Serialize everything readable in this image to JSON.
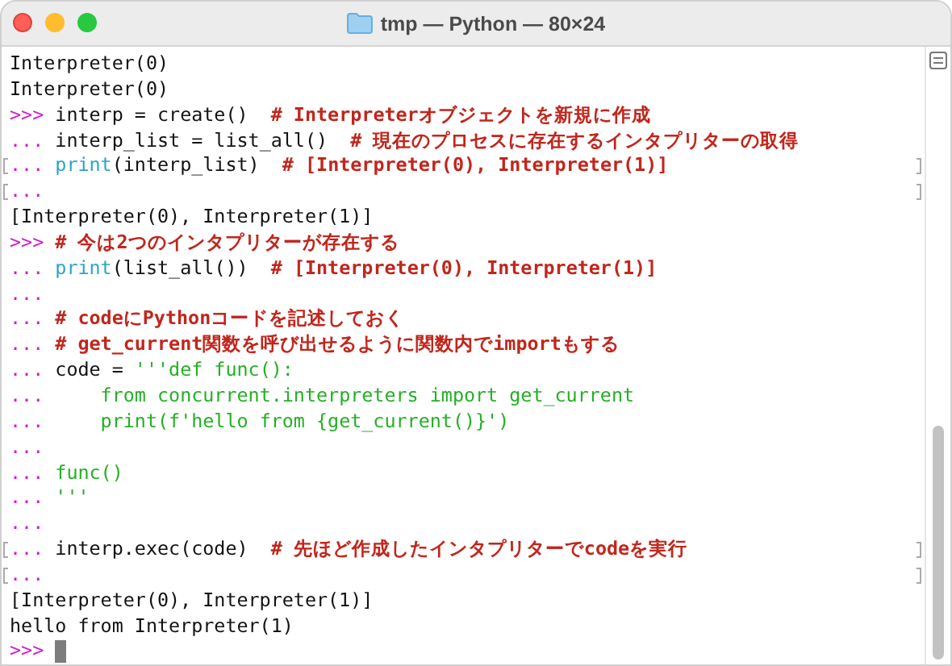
{
  "window": {
    "title": "tmp — Python — 80×24"
  },
  "lines": [
    {
      "marked": false,
      "segments": [
        {
          "kind": "output",
          "text": "Interpreter(0)"
        }
      ]
    },
    {
      "marked": false,
      "segments": [
        {
          "kind": "output",
          "text": "Interpreter(0)"
        }
      ]
    },
    {
      "marked": false,
      "segments": [
        {
          "kind": "prompt",
          "text": ">>>"
        },
        {
          "kind": "code",
          "text": " interp = create()  "
        },
        {
          "kind": "comment",
          "text": "# Interpreterオブジェクトを新規に作成"
        }
      ]
    },
    {
      "marked": false,
      "segments": [
        {
          "kind": "prompt",
          "text": "..."
        },
        {
          "kind": "code",
          "text": " interp_list = list_all()  "
        },
        {
          "kind": "comment",
          "text": "# 現在のプロセスに存在するインタプリターの取得"
        }
      ]
    },
    {
      "marked": true,
      "segments": [
        {
          "kind": "prompt",
          "text": "..."
        },
        {
          "kind": "builtin",
          "text": " print"
        },
        {
          "kind": "code",
          "text": "(interp_list)  "
        },
        {
          "kind": "comment",
          "text": "# [Interpreter(0), Interpreter(1)]"
        }
      ]
    },
    {
      "marked": true,
      "segments": [
        {
          "kind": "prompt",
          "text": "..."
        }
      ]
    },
    {
      "marked": false,
      "segments": [
        {
          "kind": "output",
          "text": "[Interpreter(0), Interpreter(1)]"
        }
      ]
    },
    {
      "marked": false,
      "segments": [
        {
          "kind": "prompt",
          "text": ">>>"
        },
        {
          "kind": "comment",
          "text": " # 今は2つのインタプリターが存在する"
        }
      ]
    },
    {
      "marked": false,
      "segments": [
        {
          "kind": "prompt",
          "text": "..."
        },
        {
          "kind": "builtin",
          "text": " print"
        },
        {
          "kind": "code",
          "text": "(list_all())  "
        },
        {
          "kind": "comment",
          "text": "# [Interpreter(0), Interpreter(1)]"
        }
      ]
    },
    {
      "marked": false,
      "segments": [
        {
          "kind": "prompt",
          "text": "..."
        }
      ]
    },
    {
      "marked": false,
      "segments": [
        {
          "kind": "prompt",
          "text": "..."
        },
        {
          "kind": "comment",
          "text": " # codeにPythonコードを記述しておく"
        }
      ]
    },
    {
      "marked": false,
      "segments": [
        {
          "kind": "prompt",
          "text": "..."
        },
        {
          "kind": "comment",
          "text": " # get_current関数を呼び出せるように関数内でimportもする"
        }
      ]
    },
    {
      "marked": false,
      "segments": [
        {
          "kind": "prompt",
          "text": "..."
        },
        {
          "kind": "code",
          "text": " code = "
        },
        {
          "kind": "string",
          "text": "'''def func():"
        }
      ]
    },
    {
      "marked": false,
      "segments": [
        {
          "kind": "prompt",
          "text": "..."
        },
        {
          "kind": "string",
          "text": "     from concurrent.interpreters import get_current"
        }
      ]
    },
    {
      "marked": false,
      "segments": [
        {
          "kind": "prompt",
          "text": "..."
        },
        {
          "kind": "string",
          "text": "     print(f'hello from {get_current()}')"
        }
      ]
    },
    {
      "marked": false,
      "segments": [
        {
          "kind": "prompt",
          "text": "..."
        }
      ]
    },
    {
      "marked": false,
      "segments": [
        {
          "kind": "prompt",
          "text": "..."
        },
        {
          "kind": "string",
          "text": " func()"
        }
      ]
    },
    {
      "marked": false,
      "segments": [
        {
          "kind": "prompt",
          "text": "..."
        },
        {
          "kind": "string",
          "text": " '''"
        }
      ]
    },
    {
      "marked": false,
      "segments": [
        {
          "kind": "prompt",
          "text": "..."
        }
      ]
    },
    {
      "marked": true,
      "segments": [
        {
          "kind": "prompt",
          "text": "..."
        },
        {
          "kind": "code",
          "text": " interp.exec(code)  "
        },
        {
          "kind": "comment",
          "text": "# 先ほど作成したインタプリターでcodeを実行"
        }
      ]
    },
    {
      "marked": true,
      "segments": [
        {
          "kind": "prompt",
          "text": "..."
        }
      ]
    },
    {
      "marked": false,
      "segments": [
        {
          "kind": "output",
          "text": "[Interpreter(0), Interpreter(1)]"
        }
      ]
    },
    {
      "marked": false,
      "segments": [
        {
          "kind": "output",
          "text": "hello from Interpreter(1)"
        }
      ]
    },
    {
      "marked": false,
      "segments": [
        {
          "kind": "prompt",
          "text": ">>>"
        }
      ],
      "cursor": true
    }
  ]
}
